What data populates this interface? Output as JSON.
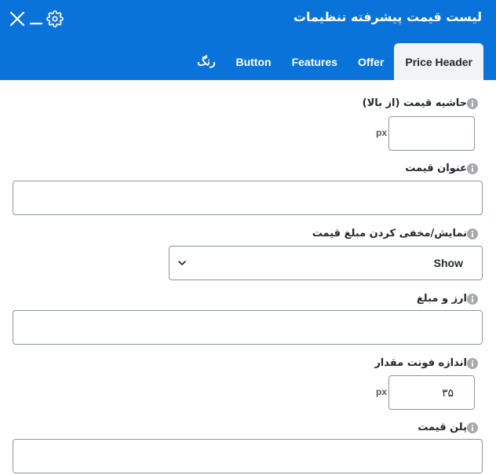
{
  "header": {
    "title": "لیست قیمت پیشرفته تنظیمات",
    "background": "#0a73d9",
    "controls": [
      "close-icon",
      "minimize-icon",
      "gear-icon"
    ]
  },
  "tabs": [
    {
      "label": "Price Header",
      "active": true
    },
    {
      "label": "Offer",
      "active": false
    },
    {
      "label": "Features",
      "active": false
    },
    {
      "label": "Button",
      "active": false
    },
    {
      "label": "رنگ",
      "active": false
    }
  ],
  "fields": {
    "top_margin": {
      "label": "حاشیه قیمت (از بالا)",
      "value": "",
      "unit": "px"
    },
    "price_title": {
      "label": "عنوان قیمت",
      "value": ""
    },
    "show_hide_amount": {
      "label": "نمایش/مخفی کردن مبلغ قیمت",
      "selected": "Show"
    },
    "currency_amount": {
      "label": "ارز و مبلغ",
      "value": ""
    },
    "font_size": {
      "label": "اندازه فونت مقدار",
      "value": "۳۵",
      "unit": "px"
    },
    "price_plan": {
      "label": "پلن قیمت",
      "value": ""
    }
  },
  "icons": {
    "info": "info-icon",
    "select": "chevron-down-icon"
  }
}
